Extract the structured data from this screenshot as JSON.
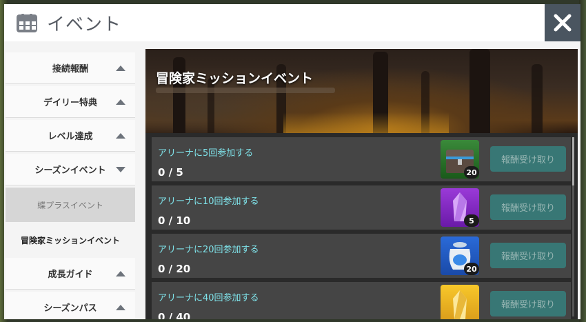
{
  "header": {
    "title": "イベント",
    "icon": "calendar-icon",
    "close_icon": "close-icon"
  },
  "sidebar": {
    "items": [
      {
        "label": "接続報酬",
        "state": "collapsed"
      },
      {
        "label": "デイリー特典",
        "state": "collapsed"
      },
      {
        "label": "レベル達成",
        "state": "collapsed"
      },
      {
        "label": "シーズンイベント",
        "state": "expanded"
      }
    ],
    "sub_items": [
      {
        "label": "蝶プラスイベント"
      },
      {
        "label": "冒険家ミッションイベント"
      }
    ],
    "items_after": [
      {
        "label": "成長ガイド",
        "state": "collapsed"
      },
      {
        "label": "シーズンパス",
        "state": "collapsed"
      }
    ]
  },
  "event": {
    "title": "冒険家ミッションイベント",
    "missions": [
      {
        "label": "アリーナに5回参加する",
        "progress": "0 / 5",
        "reward_count": "20",
        "reward_icon": "treasure-chest-icon",
        "button": "報酬受け取り"
      },
      {
        "label": "アリーナに10回参加する",
        "progress": "0 / 10",
        "reward_count": "5",
        "reward_icon": "purple-crystal-icon",
        "button": "報酬受け取り"
      },
      {
        "label": "アリーナに20回参加する",
        "progress": "0 / 20",
        "reward_count": "20",
        "reward_icon": "blue-jar-icon",
        "button": "報酬受け取り"
      },
      {
        "label": "アリーナに40回参加する",
        "progress": "0 / 40",
        "reward_count": "",
        "reward_icon": "gold-crystal-icon",
        "button": "報酬受け取り"
      }
    ]
  },
  "colors": {
    "accent_button": "#36807e",
    "mission_text": "#7fe3ea"
  }
}
